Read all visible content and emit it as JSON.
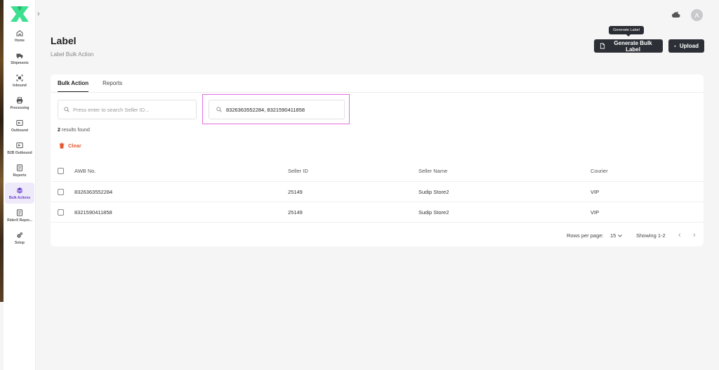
{
  "app": {
    "logo": "x-logo"
  },
  "sidebar": {
    "items": [
      {
        "label": "Home",
        "icon": "home-icon"
      },
      {
        "label": "Shipments",
        "icon": "truck-icon"
      },
      {
        "label": "Inbound",
        "icon": "scan-icon"
      },
      {
        "label": "Processing",
        "icon": "printer-icon"
      },
      {
        "label": "Outbound",
        "icon": "outbound-icon"
      },
      {
        "label": "B2B Outbound",
        "icon": "b2b-outbound-icon"
      },
      {
        "label": "Reports",
        "icon": "reports-icon"
      },
      {
        "label": "Bulk Actions",
        "icon": "layers-icon",
        "active": true
      },
      {
        "label": "RiderX Repor...",
        "icon": "rider-report-icon"
      },
      {
        "label": "Setup",
        "icon": "gears-icon"
      }
    ]
  },
  "topbar": {
    "avatar_initial": "A"
  },
  "header": {
    "title": "Label",
    "subtitle": "Label Bulk Action",
    "tooltip": "Generate Label",
    "generate_label": "Generate Bulk Label",
    "upload_label": "Upload"
  },
  "tabs": [
    {
      "label": "Bulk Action",
      "active": true
    },
    {
      "label": "Reports",
      "active": false
    }
  ],
  "search": {
    "seller_placeholder": "Press enter to search Seller ID...",
    "awb_value": "8326363552284, 8321590411858"
  },
  "results": {
    "count": "2",
    "text": "results found"
  },
  "clear_label": "Clear",
  "table": {
    "columns": [
      "AWB No.",
      "Seller ID",
      "Seller Name",
      "Courier"
    ],
    "rows": [
      {
        "awb": "8326363552284",
        "seller_id": "25149",
        "seller_name": "Sudip Store2",
        "courier": "VIP"
      },
      {
        "awb": "8321590411858",
        "seller_id": "25149",
        "seller_name": "Sudip Store2",
        "courier": "VIP"
      }
    ]
  },
  "pagination": {
    "rows_per_page_label": "Rows per page:",
    "rows_per_page": "15",
    "showing": "Showing 1-2"
  },
  "colors": {
    "accent": "#6a43c9",
    "danger": "#e4572e",
    "button_dark": "#2c3036",
    "logo_green": "#3ee08f"
  }
}
